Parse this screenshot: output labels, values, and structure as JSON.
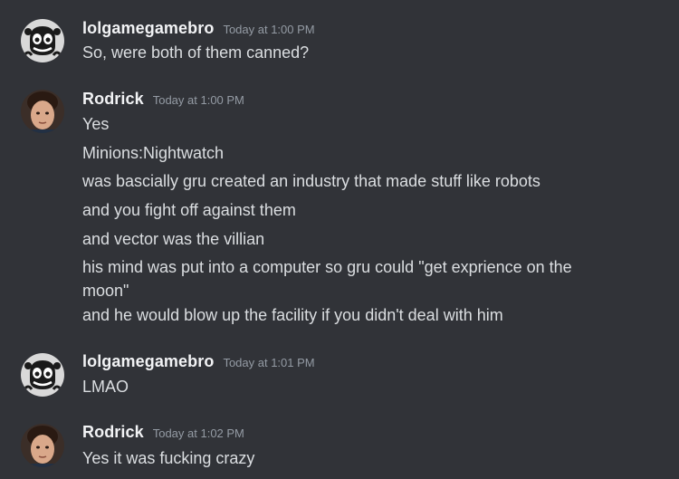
{
  "messages": [
    {
      "author": "lolgamegamebro",
      "timestamp": "Today at 1:00 PM",
      "avatar_icon": "cartoon-skull-avatar",
      "lines": [
        "So, were both of them canned?"
      ]
    },
    {
      "author": "Rodrick",
      "timestamp": "Today at 1:00 PM",
      "avatar_icon": "boy-photo-avatar",
      "lines": [
        "Yes",
        "Minions:Nightwatch",
        "was bascially gru created an industry that made stuff like robots",
        "and you fight off against them",
        "and vector was the villian",
        "his mind was put into a computer so gru could \"get exprience on the",
        "moon\"",
        "and he would blow up the facility if you didn't deal with him"
      ]
    },
    {
      "author": "lolgamegamebro",
      "timestamp": "Today at 1:01 PM",
      "avatar_icon": "cartoon-skull-avatar",
      "lines": [
        "LMAO"
      ]
    },
    {
      "author": "Rodrick",
      "timestamp": "Today at 1:02 PM",
      "avatar_icon": "boy-photo-avatar",
      "lines": [
        "Yes it was fucking crazy"
      ]
    }
  ],
  "colors": {
    "background": "#313338",
    "username": "#f2f3f5",
    "timestamp": "#949ba4",
    "message_text": "#dbdee1"
  }
}
